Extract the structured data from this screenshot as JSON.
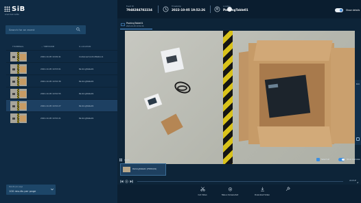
{
  "app": {
    "logo_text": "SiB",
    "logo_subtext": "smart item buffer"
  },
  "sidebar": {
    "search_placeholder": "Search for an event",
    "columns": [
      "THUMBNAIL",
      "TIMESTAMP",
      "LOCATION"
    ],
    "rows": [
      {
        "timestamp": "2022-10-05 19:49:41",
        "location": "ContainerControlStation1",
        "selected": false
      },
      {
        "timestamp": "2022-10-05 19:53:01",
        "location": "PackingTable01",
        "selected": false
      },
      {
        "timestamp": "2022-10-05 19:52:36",
        "location": "PackingTable01",
        "selected": false
      },
      {
        "timestamp": "2022-10-05 19:52:55",
        "location": "PackingTable01",
        "selected": false
      },
      {
        "timestamp": "2022-10-05 19:52:27",
        "location": "PackingTable01",
        "selected": true
      },
      {
        "timestamp": "2022-10-05 19:52:21",
        "location": "PackingTable01",
        "selected": false
      }
    ],
    "page_size": {
      "label": "Results per page",
      "value": "100 results per page"
    }
  },
  "topbar": {
    "event_id": {
      "key": "Event ID",
      "value": "7948284782234"
    },
    "timestamp": {
      "key": "Timestamp",
      "value": "2022-10-05 19:52:26"
    },
    "location": {
      "key": "Location",
      "value": "PackingTable01"
    },
    "toggle_label": "Show details"
  },
  "main": {
    "tab": {
      "title": "PackingTable01",
      "subtitle": "2022-10-05 19:52:26"
    },
    "right_panel_label": "Edit",
    "clips": {
      "title": "CLIPS",
      "select_all": "Select all",
      "show_overview": "Show overview",
      "items": [
        {
          "name": "PackingTable01 (PTZ01/01)"
        }
      ]
    },
    "zoom_label": "Width"
  },
  "actions": [
    {
      "icon": "scissors-icon",
      "label": "Cut Video"
    },
    {
      "icon": "camera-icon",
      "label": "Take a Screenshot"
    },
    {
      "icon": "download-icon",
      "label": "Download Video"
    },
    {
      "icon": "pin-icon",
      "label": ""
    }
  ],
  "colors": {
    "accent": "#3d8fe0",
    "sidebar_bg": "#0f2a43",
    "topbar_bg": "#0a1d2f"
  }
}
